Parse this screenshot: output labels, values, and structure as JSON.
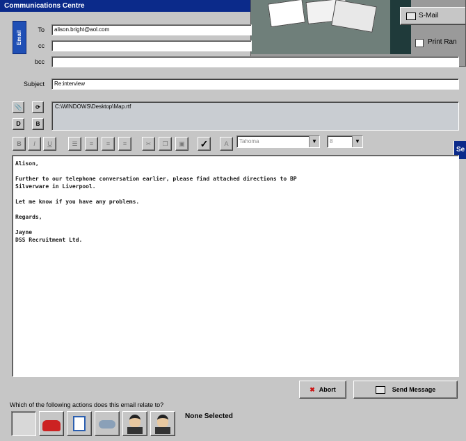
{
  "window": {
    "title": "Communications Centre"
  },
  "sidebar_tab": {
    "label": "Email"
  },
  "fields": {
    "to_label": "To",
    "to_value": "alison.bright@aol.com",
    "cc_label": "cc",
    "cc_value": "",
    "bcc_label": "bcc",
    "bcc_value": "",
    "subject_label": "Subject",
    "subject_value": "Re:interview"
  },
  "attachments": {
    "path": "C:\\WINDOWS\\Desktop\\Map.rtf"
  },
  "format_toolbar": {
    "font": "Tahoma",
    "size": "8"
  },
  "message": {
    "body": "Alison,\n\nFurther to our telephone conversation earlier, please find attached directions to BP\nSilverware in Liverpool.\n\nLet me know if you have any problems.\n\nRegards,\n\nJayne\nDSS Recruitment Ltd."
  },
  "buttons": {
    "abort": "Abort",
    "send": "Send Message",
    "smail": "S-Mail",
    "print": "Print Ran"
  },
  "actions": {
    "question": "Which of the following actions does this email relate to?",
    "status": "None Selected"
  },
  "side_panel": {
    "title": "Se"
  },
  "colors": {
    "titlebar": "#0b2a8a",
    "tab": "#1f4fb5",
    "abort_icon": "#cc1111"
  }
}
